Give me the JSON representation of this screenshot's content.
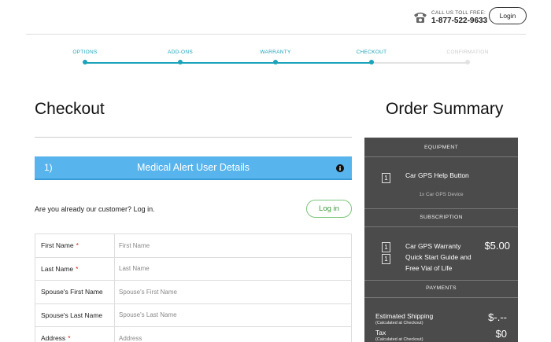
{
  "header": {
    "phone_label": "CALL US TOLL FREE:",
    "phone_number": "1-877-522-9633",
    "login_label": "Login"
  },
  "steps": [
    {
      "label": "OPTIONS",
      "state": "complete"
    },
    {
      "label": "ADD-ONS",
      "state": "complete"
    },
    {
      "label": "WARRANTY",
      "state": "complete"
    },
    {
      "label": "CHECKOUT",
      "state": "current"
    },
    {
      "label": "CONFIRMATION",
      "state": "upcoming"
    }
  ],
  "checkout": {
    "title": "Checkout",
    "section_number": "1)",
    "section_title": "Medical Alert User Details",
    "customer_question": "Are you already our customer? Log in.",
    "login_button": "Log in",
    "fields": [
      {
        "label": "First Name",
        "required": "*",
        "placeholder": "First Name"
      },
      {
        "label": "Last Name",
        "required": "*",
        "placeholder": "Last Name"
      },
      {
        "label": "Spouse's First Name",
        "required": "",
        "placeholder": "Spouse's First Name"
      },
      {
        "label": "Spouse's Last Name",
        "required": "",
        "placeholder": "Spouse's Last Name"
      },
      {
        "label": "Address",
        "required": "*",
        "placeholder": "Address"
      }
    ]
  },
  "summary": {
    "title": "Order Summary",
    "equipment_heading": "EQUIPMENT",
    "equipment_qty": "1",
    "equipment_item": "Car GPS Help Button",
    "equipment_sub": "1x Car GPS Device",
    "subscription_heading": "SUBSCRIPTION",
    "subscription_qty_1": "1",
    "subscription_qty_2": "1",
    "subscription_line_1": "Car GPS Warranty",
    "subscription_line_2": "Quick Start Guide and",
    "subscription_line_3": "Free Vial of Life",
    "subscription_price": "$5.00",
    "payments_heading": "PAYMENTS",
    "shipping_label": "Estimated Shipping",
    "shipping_note": "(Calculated at Checkout)",
    "shipping_value": "$-.--",
    "tax_label": "Tax",
    "tax_note": "(Calculated at Checkout)",
    "tax_value": "$0"
  },
  "colors": {
    "accent": "#1aa3b9",
    "section_bar": "#58b4ec",
    "summary_bg": "#4a4b4a",
    "login_green": "#7cc57c",
    "required": "#dd2222"
  },
  "icons": {
    "phone": "phone-icon",
    "info": "info-icon"
  }
}
